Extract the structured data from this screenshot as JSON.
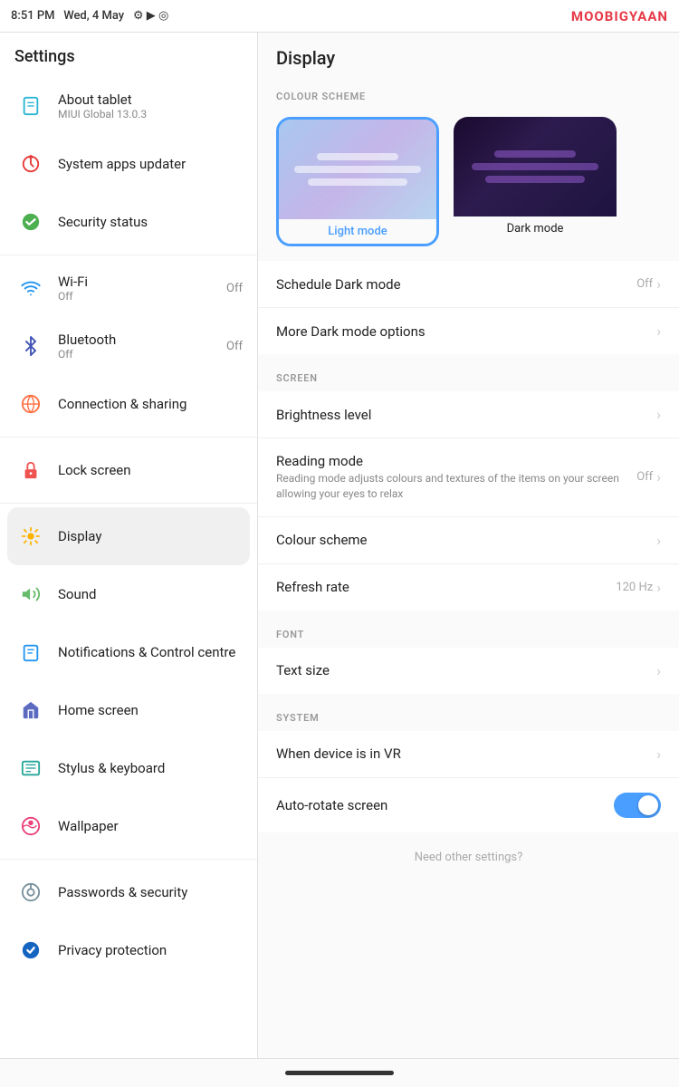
{
  "statusBar": {
    "time": "8:51 PM",
    "date": "Wed, 4 May",
    "brand": "M",
    "brandHighlight": "O",
    "brandName": "OBIGYAAN"
  },
  "leftPanel": {
    "title": "Settings",
    "items": [
      {
        "id": "about",
        "icon": "🗋",
        "iconClass": "ic-tablet",
        "label": "About tablet",
        "value": "MIUI Global 13.0.3",
        "active": false
      },
      {
        "id": "sysapps",
        "icon": "↑",
        "iconClass": "ic-update",
        "label": "System apps updater",
        "value": "",
        "active": false
      },
      {
        "id": "security",
        "icon": "✓",
        "iconClass": "ic-security",
        "label": "Security status",
        "value": "",
        "active": false
      },
      {
        "id": "wifi",
        "icon": "📶",
        "iconClass": "ic-wifi",
        "label": "Wi-Fi",
        "value": "Off",
        "active": false
      },
      {
        "id": "bluetooth",
        "icon": "❋",
        "iconClass": "ic-bluetooth",
        "label": "Bluetooth",
        "value": "Off",
        "active": false
      },
      {
        "id": "connection",
        "icon": "⊕",
        "iconClass": "ic-connection",
        "label": "Connection & sharing",
        "value": "",
        "active": false
      },
      {
        "id": "lock",
        "icon": "🔒",
        "iconClass": "ic-lock",
        "label": "Lock screen",
        "value": "",
        "active": false
      },
      {
        "id": "display",
        "icon": "☀",
        "iconClass": "ic-display",
        "label": "Display",
        "value": "",
        "active": true
      },
      {
        "id": "sound",
        "icon": "🔊",
        "iconClass": "ic-sound",
        "label": "Sound",
        "value": "",
        "active": false
      },
      {
        "id": "notifications",
        "icon": "📋",
        "iconClass": "ic-notif",
        "label": "Notifications & Control centre",
        "value": "",
        "active": false
      },
      {
        "id": "home",
        "icon": "⌂",
        "iconClass": "ic-home",
        "label": "Home screen",
        "value": "",
        "active": false
      },
      {
        "id": "stylus",
        "icon": "⌨",
        "iconClass": "ic-stylus",
        "label": "Stylus & keyboard",
        "value": "",
        "active": false
      },
      {
        "id": "wallpaper",
        "icon": "🌸",
        "iconClass": "ic-wallpaper",
        "label": "Wallpaper",
        "value": "",
        "active": false
      },
      {
        "id": "password",
        "icon": "◎",
        "iconClass": "ic-password",
        "label": "Passwords & security",
        "value": "",
        "active": false
      },
      {
        "id": "privacy",
        "icon": "🔵",
        "iconClass": "ic-privacy",
        "label": "Privacy protection",
        "value": "",
        "active": false
      }
    ]
  },
  "rightPanel": {
    "title": "Display",
    "sections": [
      {
        "label": "COLOUR SCHEME",
        "type": "themeSelector",
        "themes": [
          {
            "id": "light",
            "label": "Light mode",
            "selected": true
          },
          {
            "id": "dark",
            "label": "Dark mode",
            "selected": false
          }
        ]
      },
      {
        "label": "",
        "type": "rows",
        "rows": [
          {
            "id": "schedule-dark",
            "title": "Schedule Dark mode",
            "sub": "",
            "value": "Off",
            "hasChevron": true,
            "toggle": null
          },
          {
            "id": "more-dark",
            "title": "More Dark mode options",
            "sub": "",
            "value": "",
            "hasChevron": true,
            "toggle": null
          }
        ]
      },
      {
        "label": "SCREEN",
        "type": "rows",
        "rows": [
          {
            "id": "brightness",
            "title": "Brightness level",
            "sub": "",
            "value": "",
            "hasChevron": true,
            "toggle": null
          },
          {
            "id": "reading",
            "title": "Reading mode",
            "sub": "Reading mode adjusts colours and textures of the items on your screen allowing your eyes to relax",
            "value": "Off",
            "hasChevron": true,
            "toggle": null
          },
          {
            "id": "colour-scheme",
            "title": "Colour scheme",
            "sub": "",
            "value": "",
            "hasChevron": true,
            "toggle": null
          },
          {
            "id": "refresh-rate",
            "title": "Refresh rate",
            "sub": "",
            "value": "120 Hz",
            "hasChevron": true,
            "toggle": null
          }
        ]
      },
      {
        "label": "FONT",
        "type": "rows",
        "rows": [
          {
            "id": "text-size",
            "title": "Text size",
            "sub": "",
            "value": "",
            "hasChevron": true,
            "toggle": null
          }
        ]
      },
      {
        "label": "SYSTEM",
        "type": "rows",
        "rows": [
          {
            "id": "vr",
            "title": "When device is in VR",
            "sub": "",
            "value": "",
            "hasChevron": true,
            "toggle": null
          },
          {
            "id": "auto-rotate",
            "title": "Auto-rotate screen",
            "sub": "",
            "value": "",
            "hasChevron": false,
            "toggle": "on"
          }
        ]
      },
      {
        "label": "",
        "type": "footer",
        "text": "Need other settings?"
      }
    ]
  },
  "bottomBar": {
    "pillVisible": true
  }
}
